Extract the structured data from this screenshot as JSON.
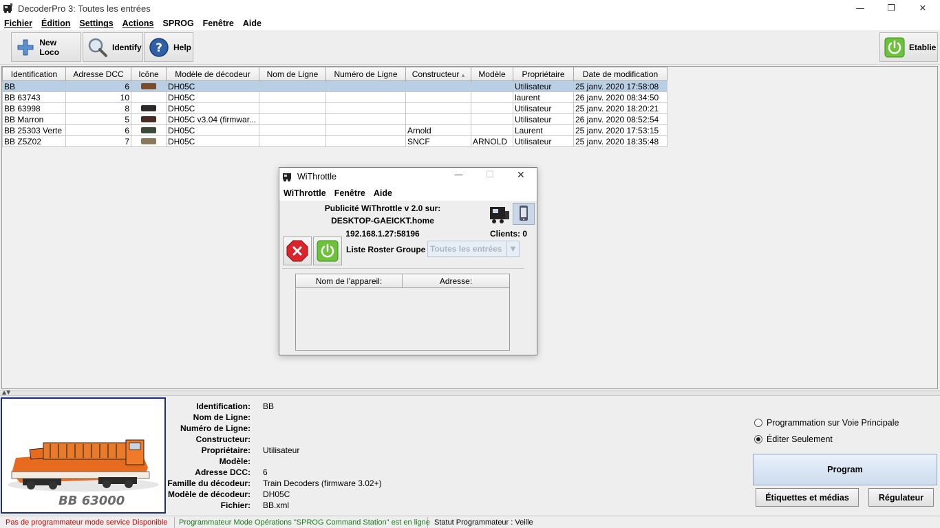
{
  "window": {
    "title": "DecoderPro 3: Toutes les entrées",
    "minimize": "—",
    "restore": "❐",
    "close": "✕"
  },
  "menu": [
    "Fichier",
    "Édition",
    "Settings",
    "Actions",
    "SPROG",
    "Fenêtre",
    "Aide"
  ],
  "toolbar": {
    "new_loco": "New Loco",
    "identify": "Identify",
    "help": "Help",
    "power_status": "Etablie"
  },
  "roster": {
    "columns": [
      "Identification",
      "Adresse DCC",
      "Icône",
      "Modèle de décodeur",
      "Nom de Ligne",
      "Numéro de Ligne",
      "Constructeur",
      "Modèle",
      "Propriétaire",
      "Date de modification"
    ],
    "sorted_column_marker": "▴",
    "rows": [
      {
        "id": "BB",
        "dcc": "6",
        "icon": "#7a4b2a",
        "decoder": "DH05C",
        "road_name": "",
        "road_number": "",
        "manufacturer": "",
        "model": "",
        "owner": "Utilisateur",
        "date": "25 janv. 2020 17:58:08"
      },
      {
        "id": "BB 63743",
        "dcc": "10",
        "icon": "",
        "decoder": "DH05C",
        "road_name": "",
        "road_number": "",
        "manufacturer": "",
        "model": "",
        "owner": "laurent",
        "date": "26 janv. 2020 08:34:50"
      },
      {
        "id": "BB 63998",
        "dcc": "8",
        "icon": "#2a2a2a",
        "decoder": "DH05C",
        "road_name": "",
        "road_number": "",
        "manufacturer": "",
        "model": "",
        "owner": "Utilisateur",
        "date": "25 janv. 2020 18:20:21"
      },
      {
        "id": "BB Marron",
        "dcc": "5",
        "icon": "#4a2a22",
        "decoder": "DH05C v3.04 (firmwar...",
        "road_name": "",
        "road_number": "",
        "manufacturer": "",
        "model": "",
        "owner": "Utilisateur",
        "date": "26 janv. 2020 08:52:54"
      },
      {
        "id": "BB 25303 Verte",
        "dcc": "6",
        "icon": "#3a4a3a",
        "decoder": "DH05C",
        "road_name": "",
        "road_number": "",
        "manufacturer": "Arnold",
        "model": "",
        "owner": "Laurent",
        "date": "25 janv. 2020 17:53:15"
      },
      {
        "id": "BB Z5Z02",
        "dcc": "7",
        "icon": "#8a7a5a",
        "decoder": "DH05C",
        "road_name": "",
        "road_number": "",
        "manufacturer": "SNCF",
        "model": "ARNOLD",
        "owner": "Utilisateur",
        "date": "25 janv. 2020 18:35:48"
      }
    ]
  },
  "photo_caption": "BB 63000",
  "details": [
    {
      "label": "Identification:",
      "value": "BB"
    },
    {
      "label": "Nom de Ligne:",
      "value": ""
    },
    {
      "label": "Numéro de Ligne:",
      "value": ""
    },
    {
      "label": "Constructeur:",
      "value": ""
    },
    {
      "label": "Propriétaire:",
      "value": "Utilisateur"
    },
    {
      "label": "Modèle:",
      "value": ""
    },
    {
      "label": "Adresse DCC:",
      "value": "6"
    },
    {
      "label": "Famille du décodeur:",
      "value": "Train Decoders (firmware 3.02+)"
    },
    {
      "label": "Modèle de décodeur:",
      "value": "DH05C"
    },
    {
      "label": "Fichier:",
      "value": "BB.xml"
    }
  ],
  "programming": {
    "main_track": "Programmation sur Voie Principale",
    "edit_only": "Éditer Seulement",
    "selected": "edit_only",
    "program": "Program",
    "labels_media": "Étiquettes et médias",
    "throttle": "Régulateur"
  },
  "status": {
    "service_mode": "Pas de programmateur mode service Disponible",
    "ops_mode": "Programmateur Mode Opérations \"SPROG Command Station\" est en ligne",
    "programmer_status": "Statut Programmateur :  Veille",
    "service_color": "#cc0000",
    "ops_color": "#1a7a1a"
  },
  "withrottle": {
    "title": "WiThrottle",
    "menu": [
      "WiThrottle",
      "Fenêtre",
      "Aide"
    ],
    "advert": "Publicité WiThrottle v 2.0 sur:",
    "host": "DESKTOP-GAEICKT.home",
    "address": "192.168.1.27:58196",
    "clients": "Clients: 0",
    "roster_group_label": "Liste Roster Groupe",
    "roster_group_value": "Toutes les entrées",
    "col_device": "Nom de l'appareil:",
    "col_address": "Adresse:"
  }
}
